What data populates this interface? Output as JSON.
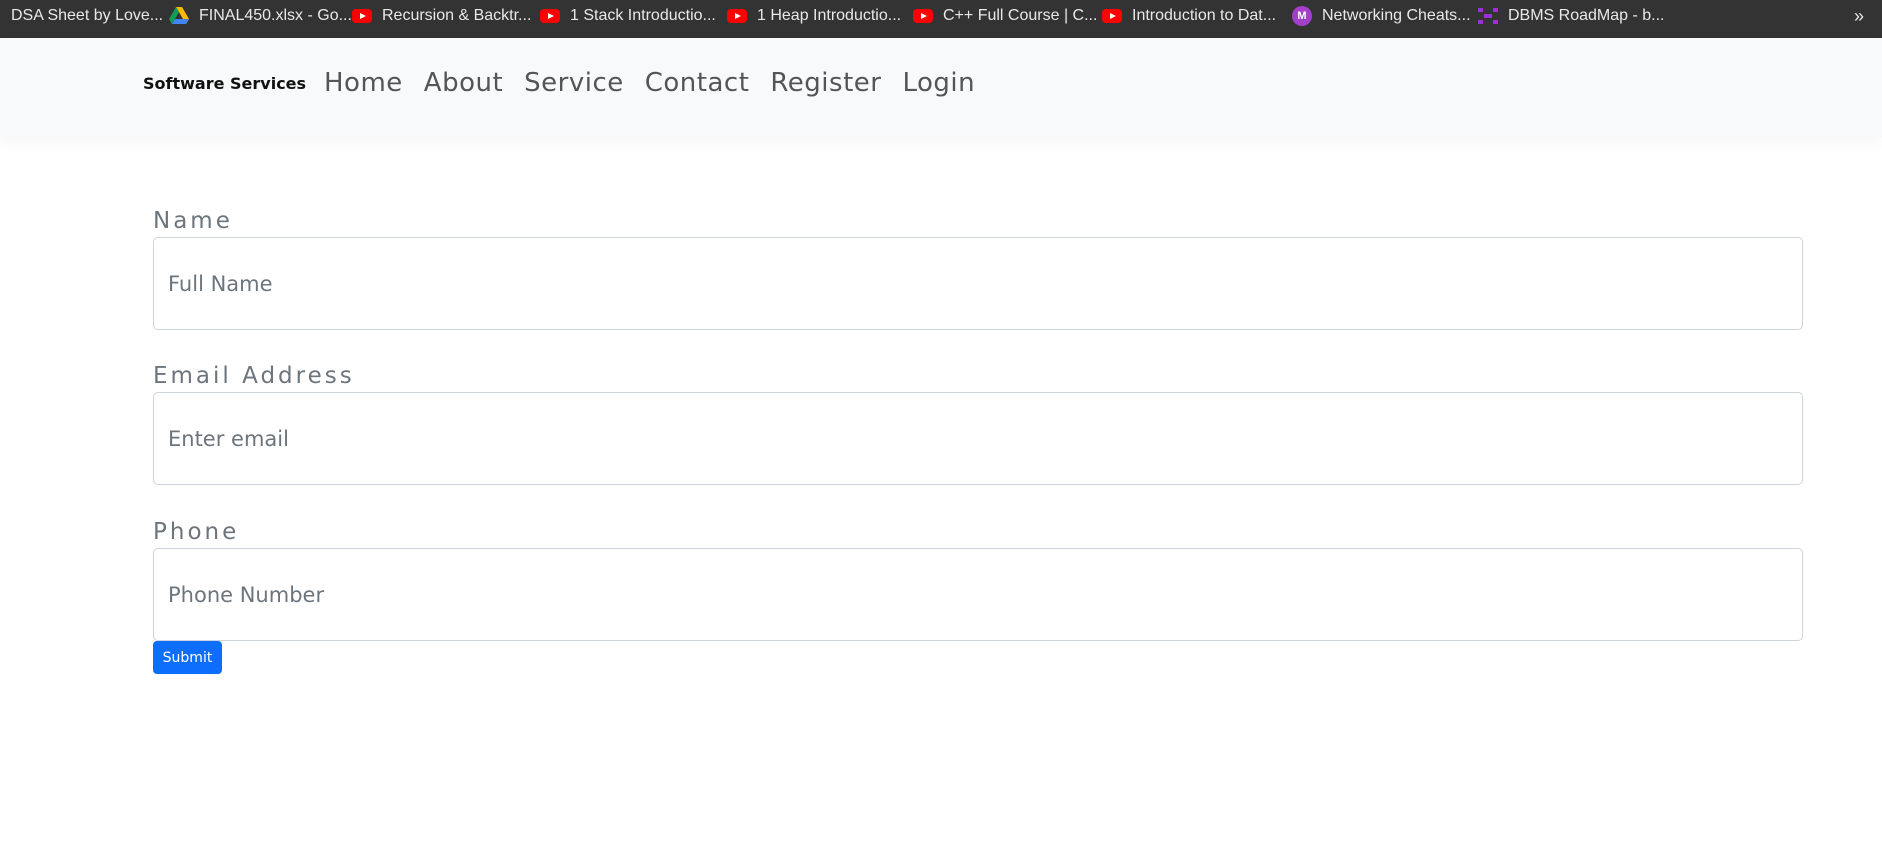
{
  "bookmarks": [
    {
      "label": "DSA Sheet by Love...",
      "icon": "none"
    },
    {
      "label": "FINAL450.xlsx - Go...",
      "icon": "google-drive-icon"
    },
    {
      "label": "Recursion & Backtr...",
      "icon": "youtube-icon"
    },
    {
      "label": "1 Stack Introductio...",
      "icon": "youtube-icon"
    },
    {
      "label": "1 Heap Introductio...",
      "icon": "youtube-icon"
    },
    {
      "label": "C++ Full Course | C...",
      "icon": "youtube-icon"
    },
    {
      "label": "Introduction to Dat...",
      "icon": "youtube-icon"
    },
    {
      "label": "Networking Cheats...",
      "icon": "m-icon"
    },
    {
      "label": "DBMS RoadMap - b...",
      "icon": "roadmap-icon"
    }
  ],
  "bookmarks_overflow": "»",
  "navbar": {
    "brand": "Software Services",
    "links": [
      "Home",
      "About",
      "Service",
      "Contact",
      "Register",
      "Login"
    ]
  },
  "form": {
    "name": {
      "label": "Name",
      "placeholder": "Full Name"
    },
    "email": {
      "label": "Email Address",
      "placeholder": "Enter email"
    },
    "phone": {
      "label": "Phone",
      "placeholder": "Phone Number"
    },
    "submit_label": "Submit"
  },
  "colors": {
    "bookmarks_bg": "#333333",
    "navbar_bg": "#f8f9fa",
    "primary": "#0d6efd",
    "label_text": "#6c757d",
    "youtube_red": "#ff0000",
    "m_badge": "#a240c9"
  },
  "m_icon_letter": "M"
}
